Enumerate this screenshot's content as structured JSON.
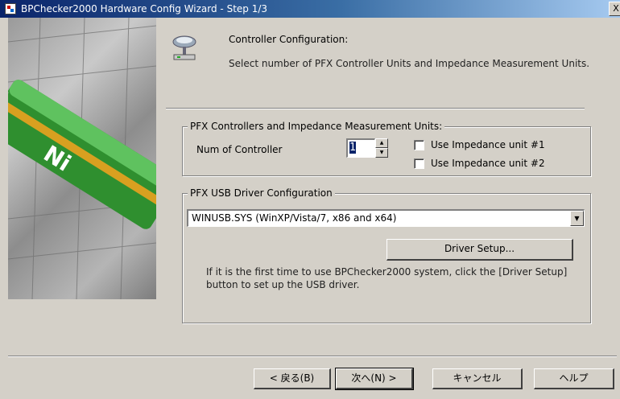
{
  "window": {
    "title": "BPChecker2000 Hardware Config Wizard - Step 1/3",
    "close_label": "X"
  },
  "header": {
    "title": "Controller Configuration:",
    "description": "Select number of PFX Controller Units and Impedance Measurement Units."
  },
  "controllers_group": {
    "title": "PFX Controllers and Impedance Measurement Units:",
    "num_label": "Num of Controller",
    "num_value": "1",
    "impedance1_label": "Use Impedance unit #1",
    "impedance1_checked": false,
    "impedance2_label": "Use Impedance unit #2",
    "impedance2_checked": false
  },
  "usb_group": {
    "title": "PFX USB Driver Configuration",
    "driver_selected": "WINUSB.SYS (WinXP/Vista/7, x86 and x64)",
    "driver_setup_label": "Driver Setup...",
    "info_text": "If it is the first time to use BPChecker2000 system, click the [Driver Setup] button to set up the USB driver."
  },
  "footer": {
    "back_label": "< 戻る(B)",
    "next_label": "次へ(N) >",
    "cancel_label": "キャンセル",
    "help_label": "ヘルプ"
  },
  "colors": {
    "face": "#d4d0c8",
    "title_bar": "#0a246a",
    "selection": "#0a246a"
  }
}
